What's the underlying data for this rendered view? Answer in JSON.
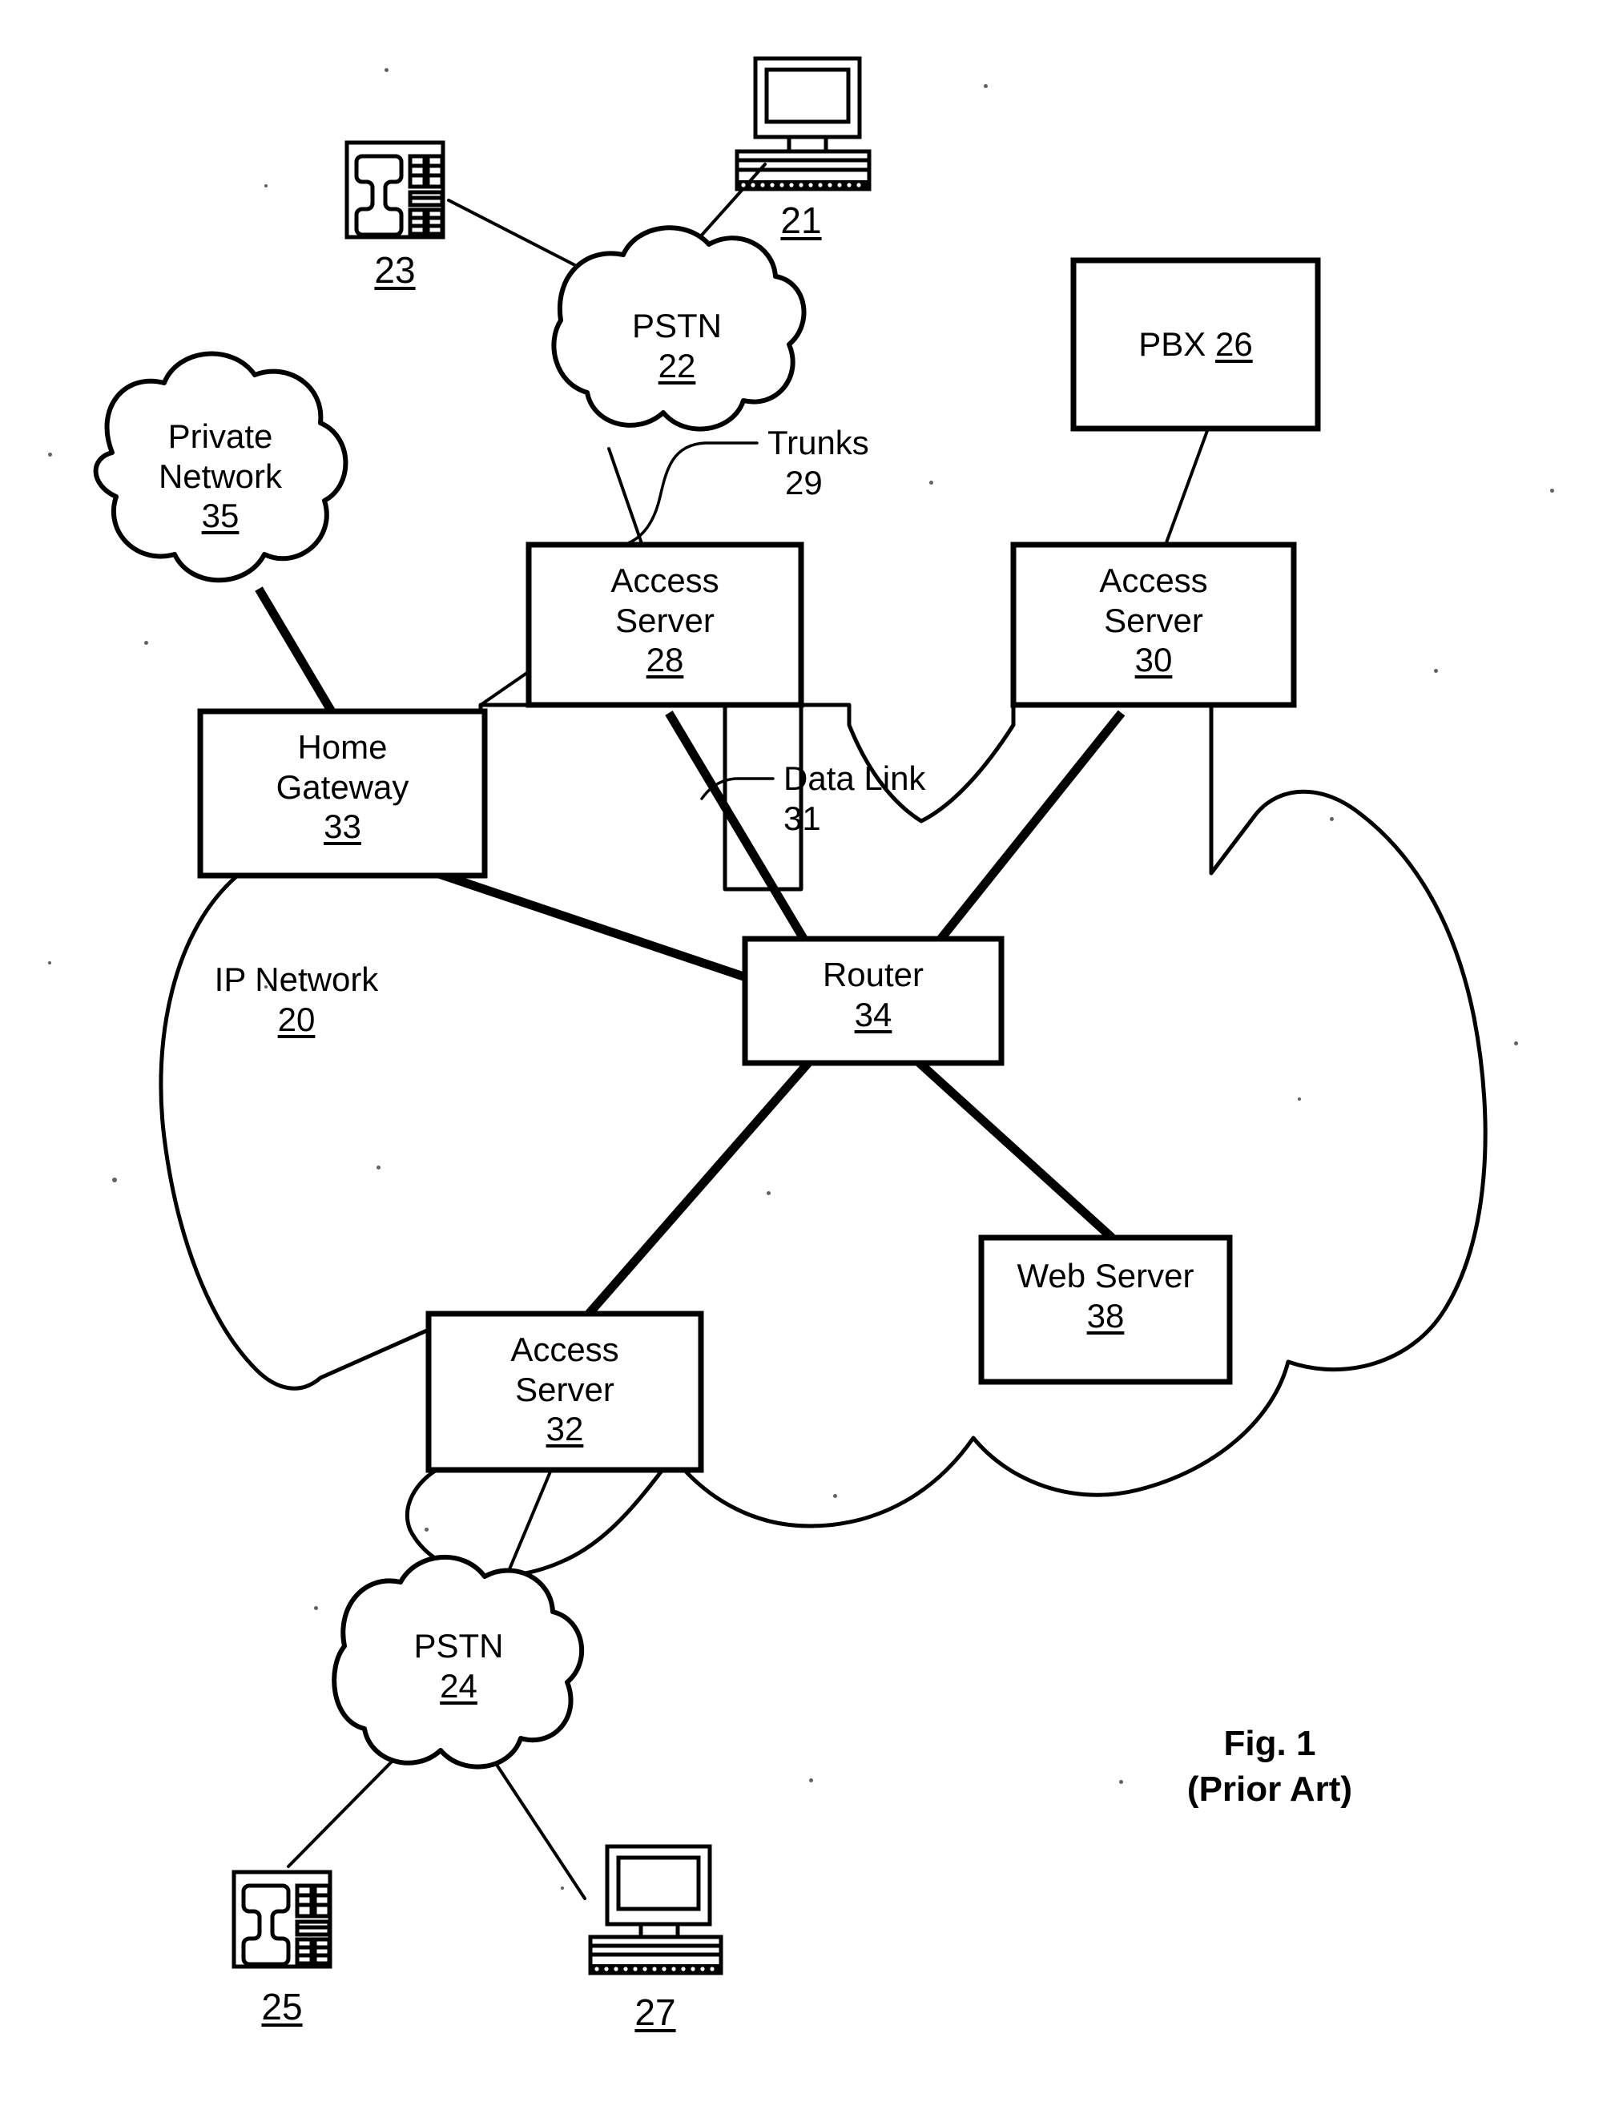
{
  "figure": {
    "caption_line1": "Fig. 1",
    "caption_line2": "(Prior Art)",
    "type": "network-architecture-diagram"
  },
  "clouds": [
    {
      "id": "pstn22",
      "name": "PSTN",
      "ref": "22"
    },
    {
      "id": "private35",
      "name_line1": "Private",
      "name_line2": "Network",
      "ref": "35"
    },
    {
      "id": "ipnet20",
      "name": "IP Network",
      "ref": "20"
    },
    {
      "id": "pstn24",
      "name": "PSTN",
      "ref": "24"
    }
  ],
  "boxes": [
    {
      "id": "as28",
      "line1": "Access",
      "line2": "Server",
      "ref": "28"
    },
    {
      "id": "as30",
      "line1": "Access",
      "line2": "Server",
      "ref": "30"
    },
    {
      "id": "as32",
      "line1": "Access",
      "line2": "Server",
      "ref": "32"
    },
    {
      "id": "pbx26",
      "inline": "PBX ",
      "ref": "26"
    },
    {
      "id": "hg33",
      "line1": "Home",
      "line2": "Gateway",
      "ref": "33"
    },
    {
      "id": "router34",
      "line1": "Router",
      "ref": "34"
    },
    {
      "id": "web38",
      "line1": "Web Server",
      "ref": "38"
    }
  ],
  "devices": [
    {
      "id": "phone23",
      "icon": "desk-telephone",
      "ref": "23"
    },
    {
      "id": "computer21",
      "icon": "desktop-computer",
      "ref": "21"
    },
    {
      "id": "phone25",
      "icon": "desk-telephone",
      "ref": "25"
    },
    {
      "id": "computer27",
      "icon": "desktop-computer",
      "ref": "27"
    }
  ],
  "annotations": [
    {
      "id": "trunks29",
      "line1": "Trunks",
      "line2": "29"
    },
    {
      "id": "datalink31",
      "line1": "Data Link",
      "line2": "31"
    }
  ],
  "labels": {
    "pstn22_name": "PSTN",
    "pstn22_ref": "22",
    "pstn24_name": "PSTN",
    "pstn24_ref": "24",
    "private_line1": "Private",
    "private_line2": "Network",
    "private_ref": "35",
    "ipnet_name": "IP Network",
    "ipnet_ref": "20",
    "access_word": "Access",
    "server_word": "Server",
    "as28_ref": "28",
    "as30_ref": "30",
    "as32_ref": "32",
    "pbx_name": "PBX ",
    "pbx_ref": "26",
    "home_word": "Home",
    "gateway_word": "Gateway",
    "hg_ref": "33",
    "router_name": "Router",
    "router_ref": "34",
    "web_name": "Web Server",
    "web_ref": "38",
    "trunks_word": "Trunks",
    "trunks_ref": "29",
    "datalink_word": "Data Link",
    "datalink_ref": "31",
    "phone23_ref": "23",
    "computer21_ref": "21",
    "phone25_ref": "25",
    "computer27_ref": "27",
    "fig_line1": "Fig. 1",
    "fig_line2": "(Prior Art)"
  },
  "connections": [
    {
      "from": "phone23",
      "to": "pstn22",
      "weight": "thin"
    },
    {
      "from": "computer21",
      "to": "pstn22",
      "weight": "thin"
    },
    {
      "from": "pstn22",
      "to": "as28",
      "weight": "thin",
      "label": "Trunks 29"
    },
    {
      "from": "pbx26",
      "to": "as30",
      "weight": "thin"
    },
    {
      "from": "private35",
      "to": "hg33",
      "weight": "thick"
    },
    {
      "from": "hg33",
      "to": "as28",
      "weight": "thin"
    },
    {
      "from": "hg33",
      "to": "router34",
      "weight": "thick"
    },
    {
      "from": "as28",
      "to": "router34",
      "weight": "thick",
      "label": "Data Link 31"
    },
    {
      "from": "as30",
      "to": "router34",
      "weight": "thick"
    },
    {
      "from": "router34",
      "to": "as32",
      "weight": "thick"
    },
    {
      "from": "router34",
      "to": "web38",
      "weight": "thick"
    },
    {
      "from": "as32",
      "to": "pstn24",
      "weight": "thin"
    },
    {
      "from": "pstn24",
      "to": "phone25",
      "weight": "thin"
    },
    {
      "from": "pstn24",
      "to": "computer27",
      "weight": "thin"
    }
  ],
  "colors": {
    "ink": "#000000",
    "paper": "#ffffff"
  }
}
